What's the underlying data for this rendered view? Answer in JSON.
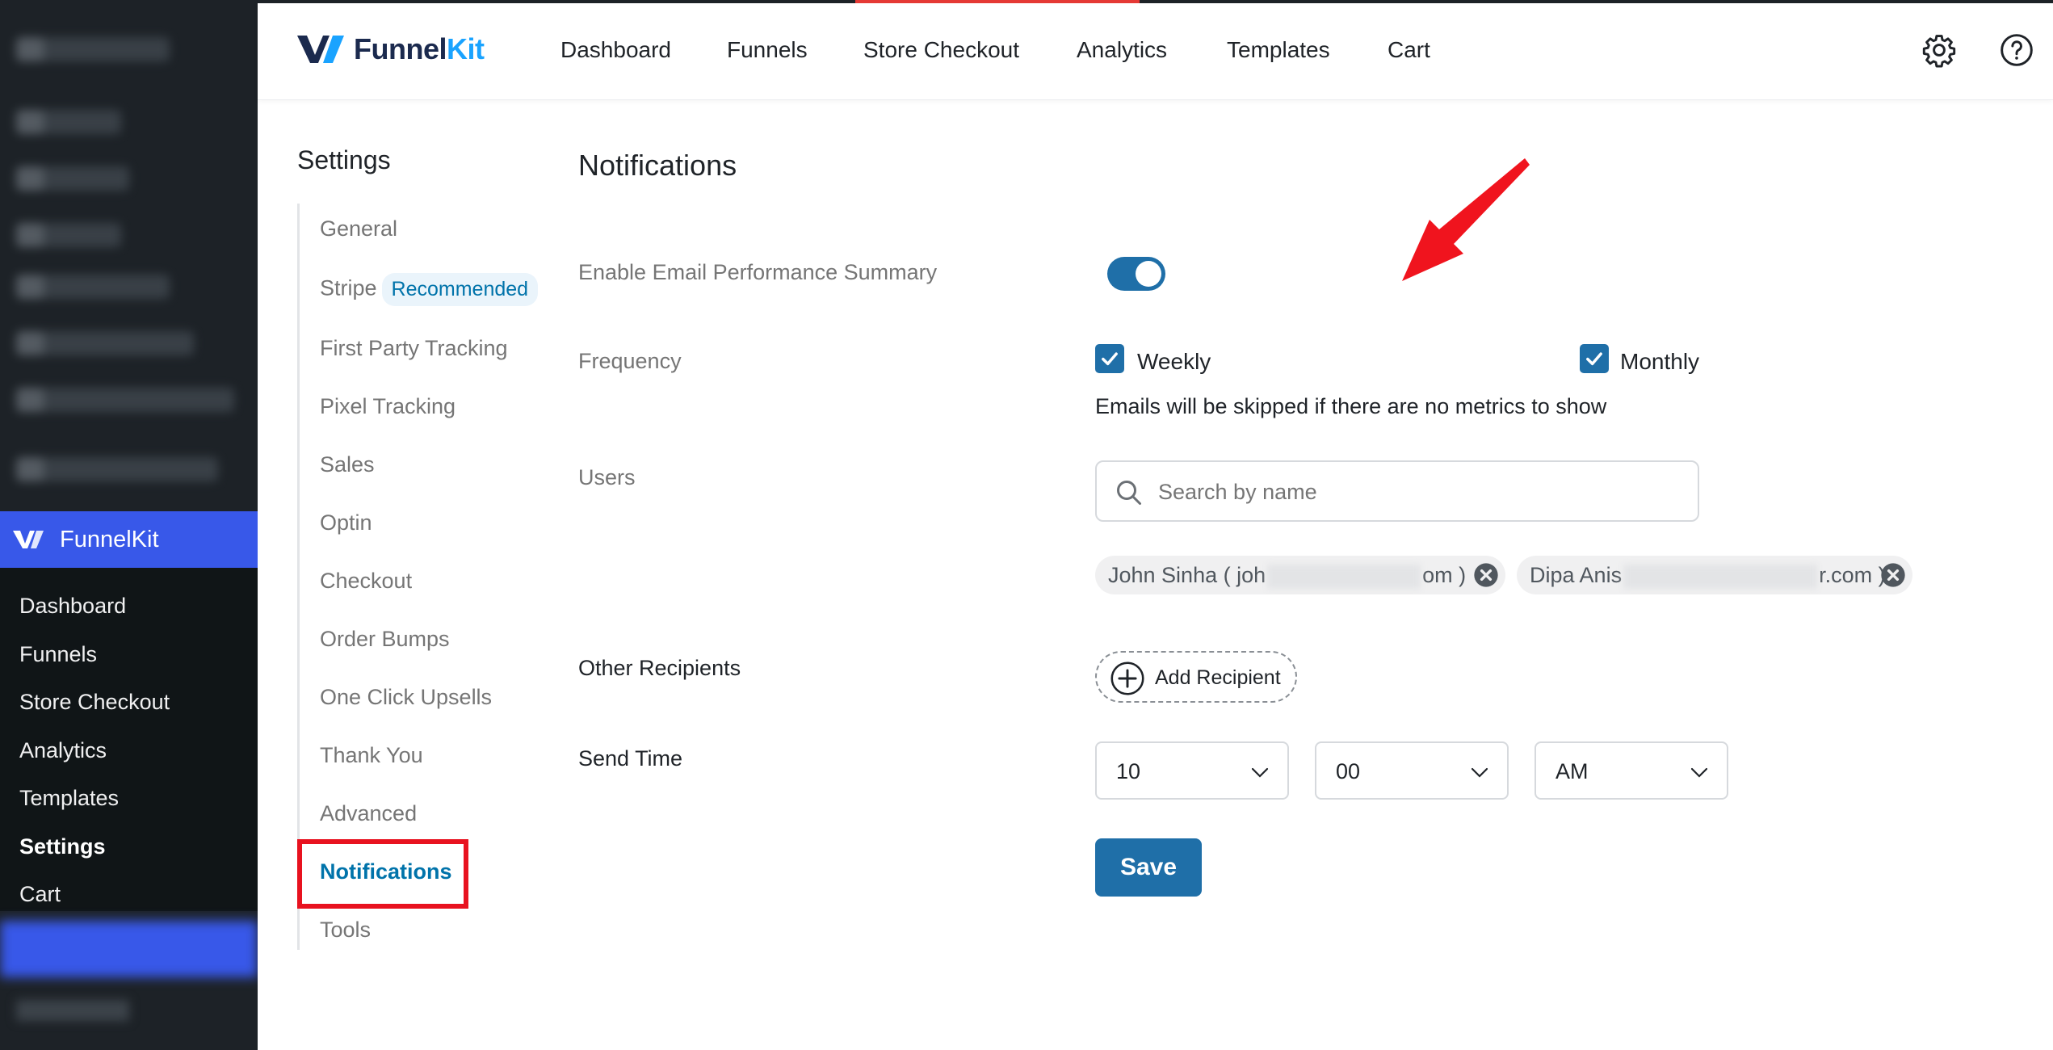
{
  "wp_sidebar": {
    "plugin_label": "FunnelKit",
    "submenu": [
      {
        "label": "Dashboard",
        "current": false
      },
      {
        "label": "Funnels",
        "current": false
      },
      {
        "label": "Store Checkout",
        "current": false
      },
      {
        "label": "Analytics",
        "current": false
      },
      {
        "label": "Templates",
        "current": false
      },
      {
        "label": "Settings",
        "current": true
      },
      {
        "label": "Cart",
        "current": false
      }
    ]
  },
  "header": {
    "brand_prefix": "Funnel",
    "brand_suffix": "Kit",
    "nav": [
      "Dashboard",
      "Funnels",
      "Store Checkout",
      "Analytics",
      "Templates",
      "Cart"
    ],
    "icons": [
      "gear-icon",
      "help-icon"
    ]
  },
  "settings_nav": {
    "title": "Settings",
    "items": [
      "General",
      "Stripe",
      "First Party Tracking",
      "Pixel Tracking",
      "Sales",
      "Optin",
      "Checkout",
      "Order Bumps",
      "One Click Upsells",
      "Thank You",
      "Advanced",
      "Notifications",
      "Tools"
    ],
    "stripe_badge": "Recommended",
    "active": "Notifications"
  },
  "panel": {
    "title": "Notifications",
    "enable_label": "Enable Email Performance Summary",
    "enable_on": true,
    "frequency_label": "Frequency",
    "frequency_options": [
      {
        "label": "Weekly",
        "checked": true
      },
      {
        "label": "Monthly",
        "checked": true
      }
    ],
    "frequency_hint": "Emails will be skipped if there are no metrics to show",
    "users_label": "Users",
    "search_placeholder": "Search by name",
    "selected_users": [
      {
        "prefix": "John Sinha ( joh",
        "suffix": "om )"
      },
      {
        "prefix": "Dipa Anis",
        "suffix": "r.com )"
      }
    ],
    "other_recipients_label": "Other Recipients",
    "add_recipient_label": "Add Recipient",
    "send_time_label": "Send Time",
    "send_time": {
      "hour": "10",
      "minute": "00",
      "period": "AM"
    },
    "save_label": "Save"
  },
  "colors": {
    "accent": "#1f6fa8",
    "wp_sidebar": "#1d2227",
    "wp_active": "#3858e9",
    "highlight_box": "#e8121f",
    "annotation_arrow": "#f0141e"
  }
}
